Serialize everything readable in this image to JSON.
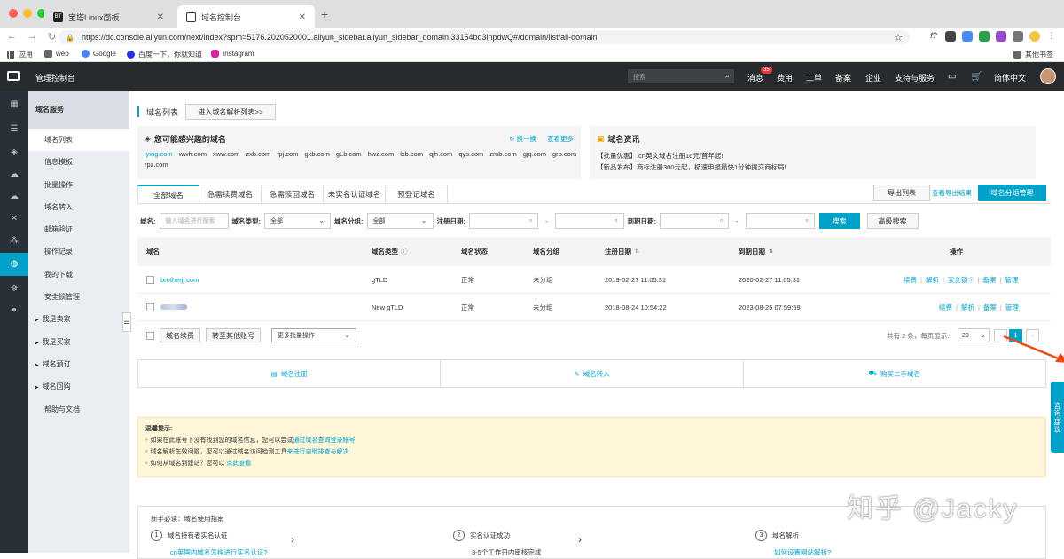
{
  "browser": {
    "tabs": [
      {
        "label": "宝塔Linux面板",
        "favicon": "BT"
      },
      {
        "label": "域名控制台"
      }
    ],
    "url": "https://dc.console.aliyun.com/next/index?spm=5176.2020520001.aliyun_sidebar.aliyun_sidebar_domain.33154bd3lnpdwQ#/domain/list/all-domain",
    "bookmarks": [
      "应用",
      "web",
      "Google",
      "百度一下，你就知道",
      "Instagram",
      "其他书签"
    ]
  },
  "console": {
    "title": "管理控制台",
    "search_placeholder": "搜索",
    "nav": [
      "消息",
      "费用",
      "工单",
      "备案",
      "企业",
      "支持与服务",
      "简体中文"
    ],
    "message_count": "35"
  },
  "sidebar": {
    "header": "域名服务",
    "items": [
      {
        "label": "域名列表",
        "active": true
      },
      {
        "label": "信息模板"
      },
      {
        "label": "批量操作"
      },
      {
        "label": "域名转入"
      },
      {
        "label": "邮箱验证"
      },
      {
        "label": "操作记录"
      },
      {
        "label": "我的下载"
      },
      {
        "label": "安全锁管理"
      },
      {
        "label": "我是卖家",
        "expandable": true
      },
      {
        "label": "我是买家",
        "expandable": true
      },
      {
        "label": "域名预订",
        "expandable": true
      },
      {
        "label": "域名回购",
        "expandable": true
      },
      {
        "label": "帮助与文档"
      }
    ]
  },
  "page": {
    "title": "域名列表",
    "dns_button": "进入域名解析列表>>",
    "interest": {
      "title": "您可能感兴趣的域名",
      "refresh": "换一换",
      "more": "查看更多",
      "domains": [
        "jying.com",
        "wwh.com",
        "xww.com",
        "zxb.com",
        "fpj.com",
        "gkb.com",
        "gLb.com",
        "hwz.com",
        "lxb.com",
        "qjh.com",
        "qys.com",
        "zmb.com",
        "gjq.com",
        "grb.com",
        "rpz.com"
      ]
    },
    "news": {
      "title": "域名资讯",
      "items": [
        "【批量优惠】.cn英文域名注册16元/首年起!",
        "【新品发布】商标注册300元起，极速申报最快1分钟提交商标局!"
      ]
    },
    "tabs": [
      "全部域名",
      "急需续费域名",
      "急需赎回域名",
      "未实名认证域名",
      "预登记域名"
    ],
    "export_list": "导出列表",
    "view_export": "查看导出结果",
    "group_manage": "域名分组管理",
    "filter": {
      "domain_label": "域名:",
      "domain_placeholder": "输入域名进行搜索",
      "type_label": "域名类型:",
      "type_value": "全部",
      "group_label": "域名分组:",
      "group_value": "全部",
      "reg_label": "注册日期:",
      "exp_label": "到期日期:",
      "dash": "-",
      "search": "搜索",
      "advanced": "高级搜索"
    },
    "table": {
      "headers": [
        "域名",
        "域名类型",
        "域名状态",
        "域名分组",
        "注册日期",
        "到期日期",
        "操作"
      ],
      "rows": [
        {
          "domain": "brotherjj.com",
          "type": "gTLD",
          "status": "正常",
          "group": "未分组",
          "reg": "2019-02-27 11:05:31",
          "exp": "2020-02-27 11:05:31",
          "ops": [
            "续费",
            "解析",
            "安全锁",
            "备案",
            "管理"
          ]
        },
        {
          "domain": "",
          "type": "New gTLD",
          "status": "正常",
          "group": "未分组",
          "reg": "2018-08-24 10:54:22",
          "exp": "2023-08-25 07:59:59",
          "ops": [
            "续费",
            "解析",
            "备案",
            "管理"
          ]
        }
      ]
    },
    "bulk": {
      "renew": "域名续费",
      "transfer": "转至其他账号",
      "more": "更多批量操作",
      "total": "共有 2 条，每页显示:",
      "page_size": "20",
      "current_page": "1"
    },
    "actions": [
      "域名注册",
      "域名转入",
      "购买二手域名"
    ],
    "tips": {
      "title": "温馨提示:",
      "items": [
        {
          "text": "如果在此账号下没有找到您的域名信息，您可以尝试",
          "link": "通过域名查询登录帐号"
        },
        {
          "text": "域名解析生效问题，您可以通过域名访问检测工具",
          "link": "来进行自助排查与解决"
        },
        {
          "text": "如何从域名到建站？您可以 ",
          "link": "点此查看"
        }
      ]
    },
    "guide": {
      "title": "新手必读：域名使用指南",
      "steps": [
        {
          "num": "1",
          "label": "域名持有者实名认证",
          "sub": "cn英国内域名怎样进行实名认证?"
        },
        {
          "num": "2",
          "label": "实名认证成功",
          "sub": "3-5个工作日内审核完成"
        },
        {
          "num": "3",
          "label": "域名解析",
          "sub": "如何设置网站解析?"
        }
      ]
    },
    "consult": "咨询·建议",
    "watermark": "知乎 @Jacky"
  }
}
